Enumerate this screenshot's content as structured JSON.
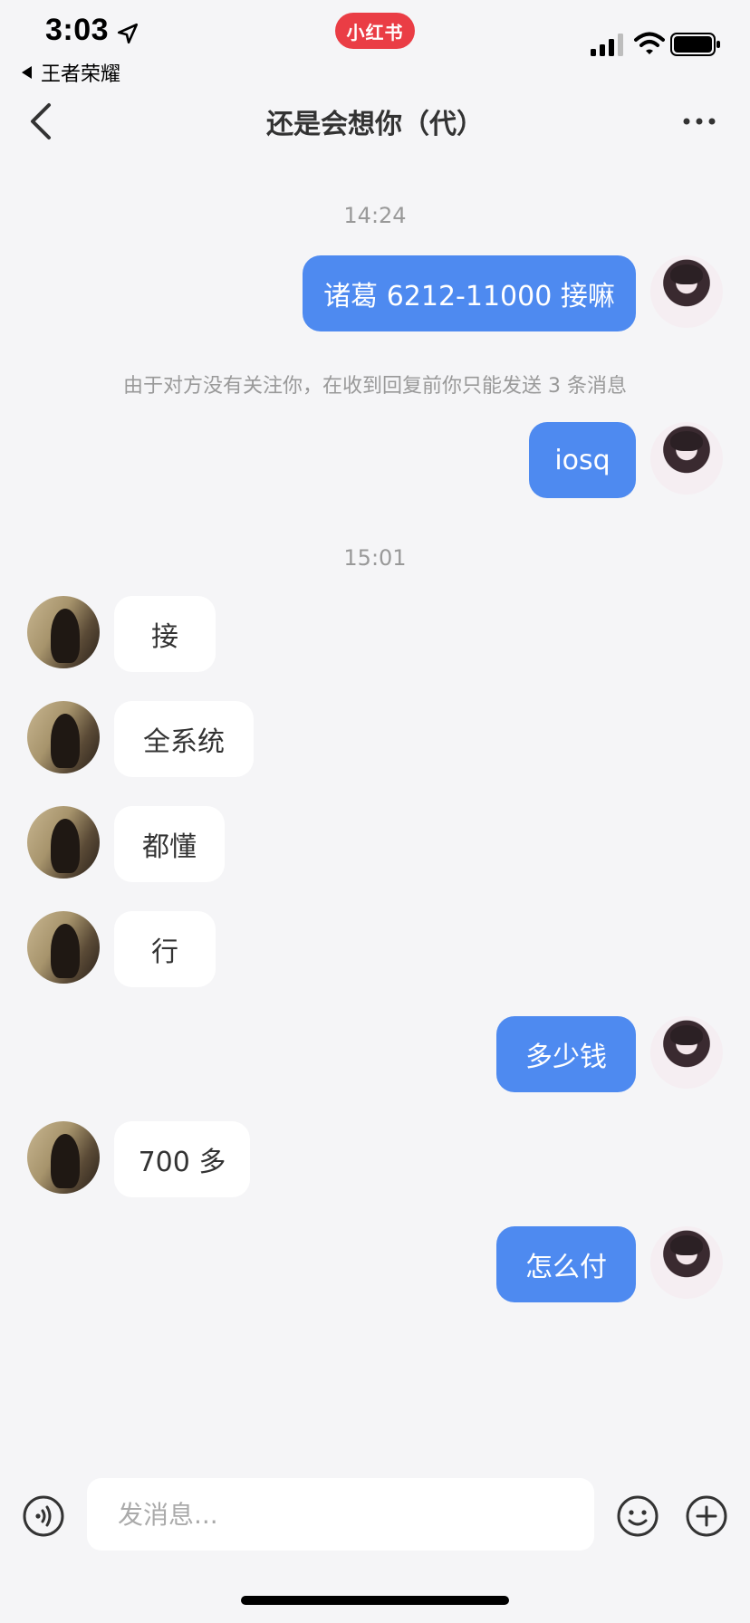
{
  "status_bar": {
    "time": "3:03",
    "back_app": "王者荣耀",
    "app_badge": "小红书"
  },
  "nav": {
    "title": "还是会想你（代）"
  },
  "messages": {
    "ts1": "14:24",
    "m1": "诸葛 6212-11000 接嘛",
    "notice": "由于对方没有关注你，在收到回复前你只能发送 3 条消息",
    "m2": "iosq",
    "ts2": "15:01",
    "m3": "接",
    "m4": "全系统",
    "m5": "都懂",
    "m6": "行",
    "m7": "多少钱",
    "m8": "700 多",
    "m9": "怎么付"
  },
  "input": {
    "placeholder": "发消息..."
  },
  "colors": {
    "my_bubble": "#4e8af0",
    "other_bubble": "#ffffff",
    "background": "#f5f5f7",
    "app_badge": "#ea3d45"
  },
  "icons": {
    "location": "location-arrow-icon",
    "signal": "cellular-signal-icon",
    "wifi": "wifi-icon",
    "battery": "battery-icon",
    "back": "chevron-left-icon",
    "more": "more-dots-icon",
    "voice": "voice-icon",
    "emoji": "emoji-icon",
    "plus": "plus-icon"
  }
}
